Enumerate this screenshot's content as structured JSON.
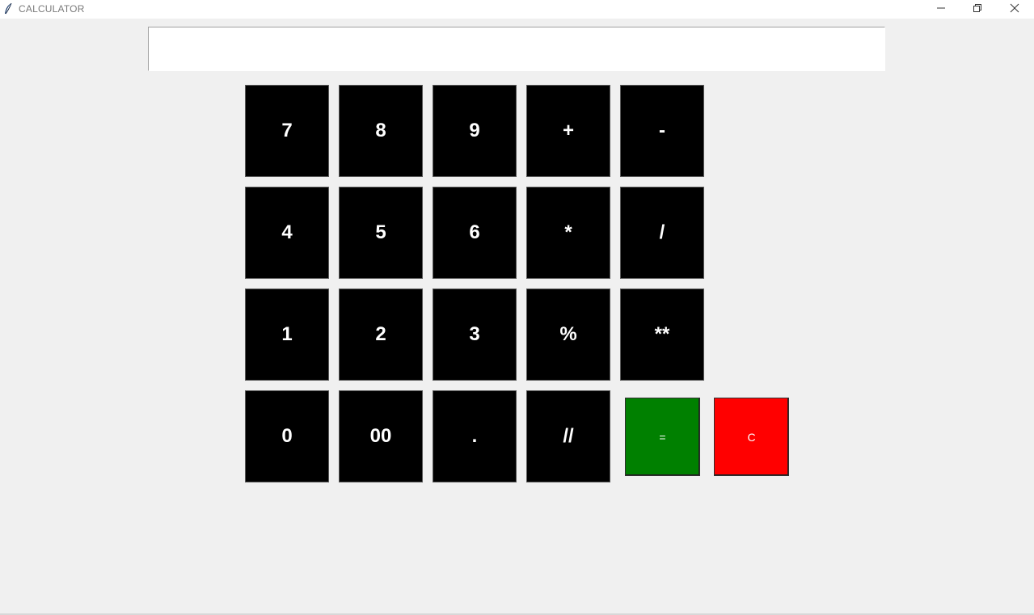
{
  "window": {
    "title": "CALCULATOR",
    "minimize_icon": "minimize-icon",
    "maximize_icon": "restore-icon",
    "close_icon": "close-icon",
    "app_icon": "feather-icon"
  },
  "display": {
    "value": ""
  },
  "keys": {
    "k7": "7",
    "k8": "8",
    "k9": "9",
    "plus": "+",
    "minus": "-",
    "k4": "4",
    "k5": "5",
    "k6": "6",
    "multiply": "*",
    "divide": "/",
    "k1": "1",
    "k2": "2",
    "k3": "3",
    "modulo": "%",
    "power": "**",
    "k0": "0",
    "k00": "00",
    "decimal": ".",
    "floor_divide": "//",
    "equals": "=",
    "clear": "C"
  },
  "colors": {
    "key_background": "#000000",
    "key_text": "#ffffff",
    "equals_background": "#008000",
    "clear_background": "#ff0000",
    "window_background": "#f0f0f0"
  }
}
